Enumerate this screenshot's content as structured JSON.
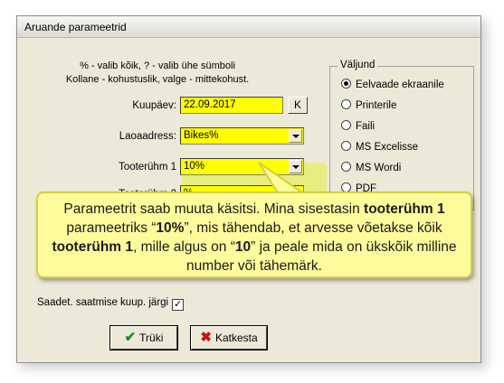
{
  "window": {
    "title": "Aruande parameetrid"
  },
  "hints": {
    "line1": "% - valib kõik, ? - valib ühe sümboli",
    "line2": "Kollane - kohustuslik, valge - mittekohust."
  },
  "fields": {
    "kuupaev": {
      "label": "Kuupäev:",
      "value": "22.09.2017",
      "button": "K"
    },
    "laoaadress": {
      "label": "Laoaadress:",
      "value": "Bikes%"
    },
    "tooteruhm1": {
      "label": "Tooterühm 1",
      "value": "10%"
    },
    "tooteruhm2": {
      "label": "Tooterühm 2",
      "value": "%"
    }
  },
  "output": {
    "title": "Väljund",
    "options": [
      "Eelvaade ekraanile",
      "Printerile",
      "Faili",
      "MS Excelisse",
      "MS Wordi",
      "PDF"
    ],
    "selected": "Eelvaade ekraanile"
  },
  "checkbox": {
    "label": "Saadet. saatmise kuup. järgi",
    "checked": true,
    "mark": "✓"
  },
  "buttons": {
    "print": "Trüki",
    "cancel": "Katkesta"
  },
  "icons": {
    "print": "check-icon",
    "cancel": "x-icon"
  },
  "callout": {
    "p1": "Parameetrit saab muuta käsitsi. Mina sisestasin ",
    "b1": "tooterühm 1",
    "p2": " parameetriks “",
    "b2": "10%",
    "p3": "”, mis tähendab, et arvesse võetakse kõik ",
    "b3": "tooterühm 1",
    "p4": ", mille algus on “",
    "b4": "10",
    "p5": "” ja peale mida on ükskõik milline number või tähemärk."
  },
  "colors": {
    "required": "#ffff00",
    "callout": "#fefb9c"
  }
}
